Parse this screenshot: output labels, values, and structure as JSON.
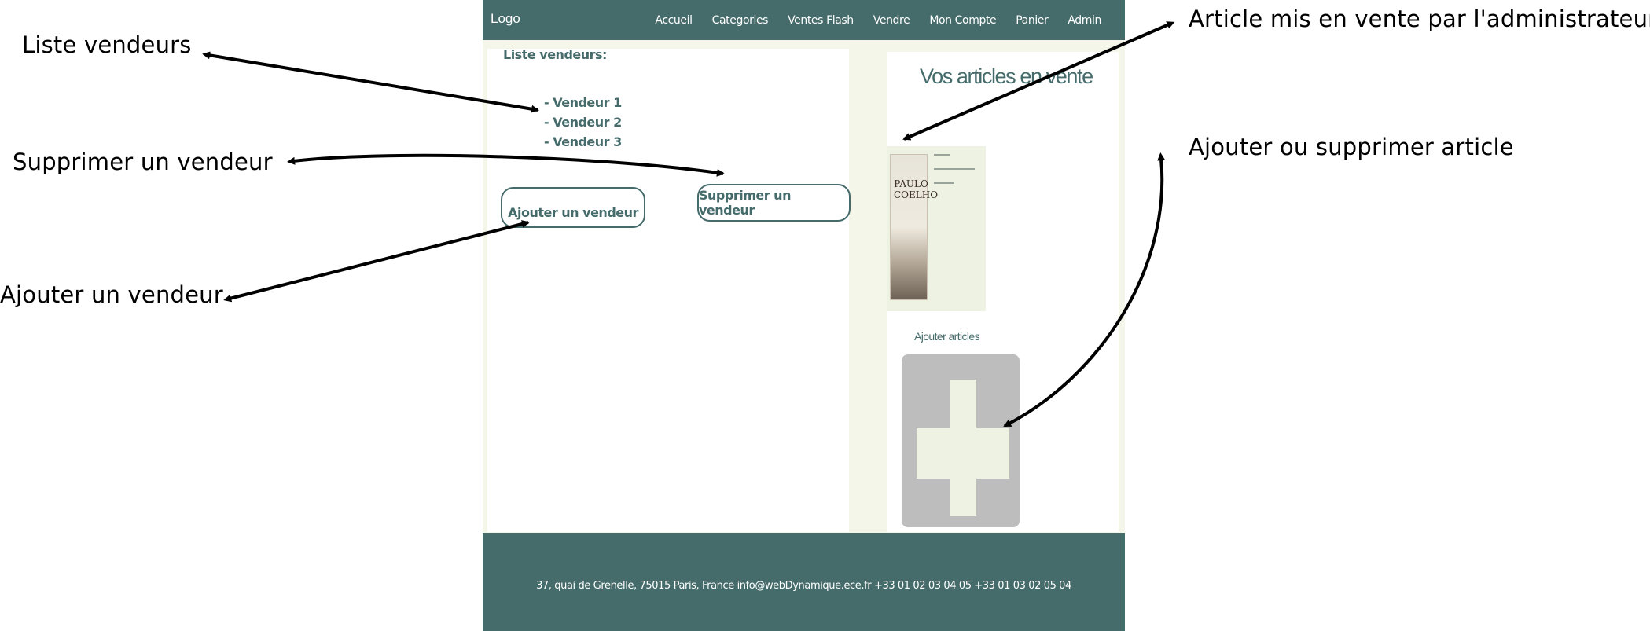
{
  "mockup": {
    "nav": {
      "logo": "Logo",
      "links": [
        "Accueil",
        "Categories",
        "Ventes Flash",
        "Vendre",
        "Mon Compte",
        "Panier",
        "Admin"
      ]
    },
    "left": {
      "title": "Liste vendeurs:",
      "vendeurs": [
        "- Vendeur 1",
        "- Vendeur 2",
        "- Vendeur 3"
      ],
      "add_button": "Ajouter un vendeur",
      "delete_button": "Supprimer un vendeur"
    },
    "right": {
      "title": "Vos articles en vente",
      "book_author": "PAULO COELHO",
      "add_label": "Ajouter articles"
    },
    "footer": {
      "text": "37, quai de Grenelle, 75015 Paris, France info@webDynamique.ece.fr +33 01 02 03 04 05 +33 01 03 02 05 04"
    }
  },
  "annotations": {
    "liste_vendeurs": "Liste vendeurs",
    "supprimer_vendeur": "Supprimer un vendeur",
    "ajouter_vendeur": "Ajouter un vendeur",
    "article_admin": "Article mis en vente par l'administrateur",
    "ajouter_supprimer_article": "Ajouter ou supprimer article"
  },
  "colors": {
    "primary": "#466b6b",
    "background": "#f4f6ea",
    "add_box": "#bdbdbd"
  }
}
